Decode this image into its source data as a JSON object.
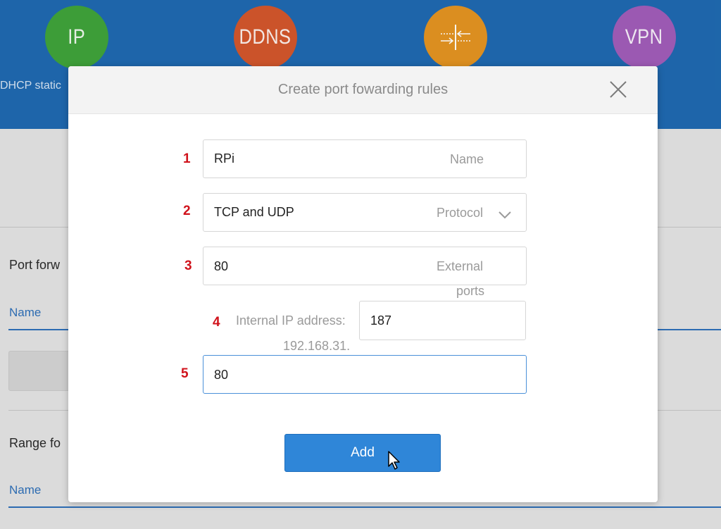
{
  "background": {
    "features": [
      {
        "label": "IP",
        "color": "#3fa33a"
      },
      {
        "label": "DDNS",
        "color": "#d2562c"
      },
      {
        "label": "",
        "color": "#e39322",
        "icon": "port-forward-icon"
      },
      {
        "label": "VPN",
        "color": "#a15cb8"
      }
    ],
    "first_feature_caption": "DHCP static",
    "sections": [
      {
        "title": "Port forw",
        "name_header": "Name"
      },
      {
        "title": "Range fo",
        "name_header": "Name"
      }
    ]
  },
  "modal": {
    "title": "Create port fowarding rules",
    "close_icon": "close-icon",
    "steps": [
      "1",
      "2",
      "3",
      "4",
      "5"
    ],
    "name_field": {
      "value": "RPi",
      "hint": "Name"
    },
    "protocol_field": {
      "value": "TCP and UDP",
      "hint": "Protocol",
      "icon": "chevron-down-icon"
    },
    "external_ports_field": {
      "value": "80",
      "hint_line1": "External",
      "hint_line2": "ports"
    },
    "internal_ip": {
      "label": "Internal IP address:",
      "prefix": "192.168.31.",
      "value": "187"
    },
    "internal_port_field": {
      "value": "80"
    },
    "add_button": "Add"
  },
  "colors": {
    "banner": "#1f69b0",
    "accent": "#2f86d8",
    "step_number": "#d0121b"
  }
}
